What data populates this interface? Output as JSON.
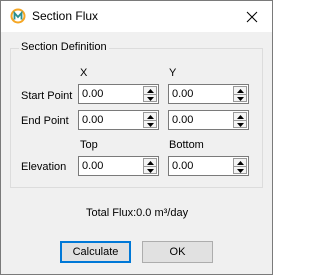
{
  "window": {
    "title": "Section Flux",
    "icon": "app-logo-icon",
    "close_icon": "close-icon"
  },
  "group": {
    "title": "Section Definition",
    "col_x": "X",
    "col_y": "Y",
    "col_top": "Top",
    "col_bottom": "Bottom"
  },
  "rows": {
    "start_point": {
      "label": "Start Point",
      "x": "0.00",
      "y": "0.00"
    },
    "end_point": {
      "label": "End Point",
      "x": "0.00",
      "y": "0.00"
    },
    "elevation": {
      "label": "Elevation",
      "top": "0.00",
      "bottom": "0.00"
    }
  },
  "result": {
    "total_flux": "Total Flux:0.0 m³/day"
  },
  "buttons": {
    "calculate": "Calculate",
    "ok": "OK"
  },
  "colors": {
    "accent": "#0078d7",
    "logo_orange": "#f5a623",
    "logo_teal": "#2a8f8f"
  }
}
